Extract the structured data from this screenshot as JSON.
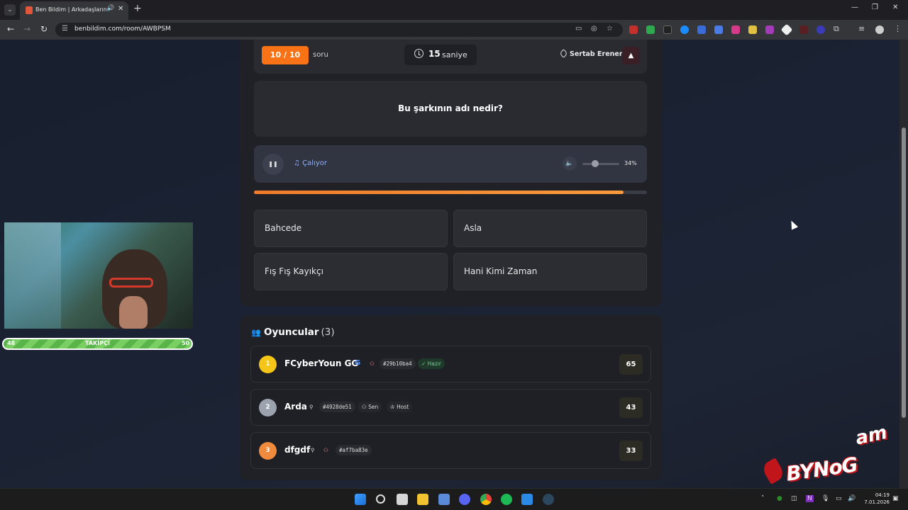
{
  "browser": {
    "tab_title": "Ben Bildim | Arkadaşlarınla",
    "url": "benbildim.com/room/AWBPSM"
  },
  "quiz": {
    "counter": "10 / 10",
    "counter_suffix": "soru",
    "timer_value": "15",
    "timer_unit": "saniye",
    "tag": "Sertab Erener",
    "report_icon": "warning-icon",
    "question": "Bu şarkının adı nedir?",
    "player": {
      "status": "Çalıyor",
      "volume_pct": "34%",
      "volume_level": 0.34,
      "progress": 0.94
    },
    "answers": [
      "Bahcede",
      "Asla",
      "Fış Fış Kayıkçı",
      "Hani Kimi Zaman"
    ]
  },
  "players_panel": {
    "title": "Oyuncular",
    "count": "(3)",
    "rows": [
      {
        "rank": "1",
        "name": "FCyberYoun GG",
        "id": "#29b10ba4",
        "badge": "Hazır",
        "score": "65"
      },
      {
        "rank": "2",
        "name": "Arda",
        "id": "#4928de51",
        "badge": "Sen",
        "badge2": "Host",
        "score": "43"
      },
      {
        "rank": "3",
        "name": "dfgdf",
        "id": "#af7ba83e",
        "score": "33"
      }
    ]
  },
  "overlay": {
    "follow_left": "48",
    "follow_label": "TAKİPÇİ",
    "follow_right": "50"
  },
  "taskbar": {
    "time": "04:19",
    "date": "7.01.2026"
  },
  "colors": {
    "accent": "#f97316",
    "rank1": "#f5c518",
    "rank2": "#9ca3af",
    "rank3": "#f08a3c",
    "player_bg": "#313441"
  }
}
